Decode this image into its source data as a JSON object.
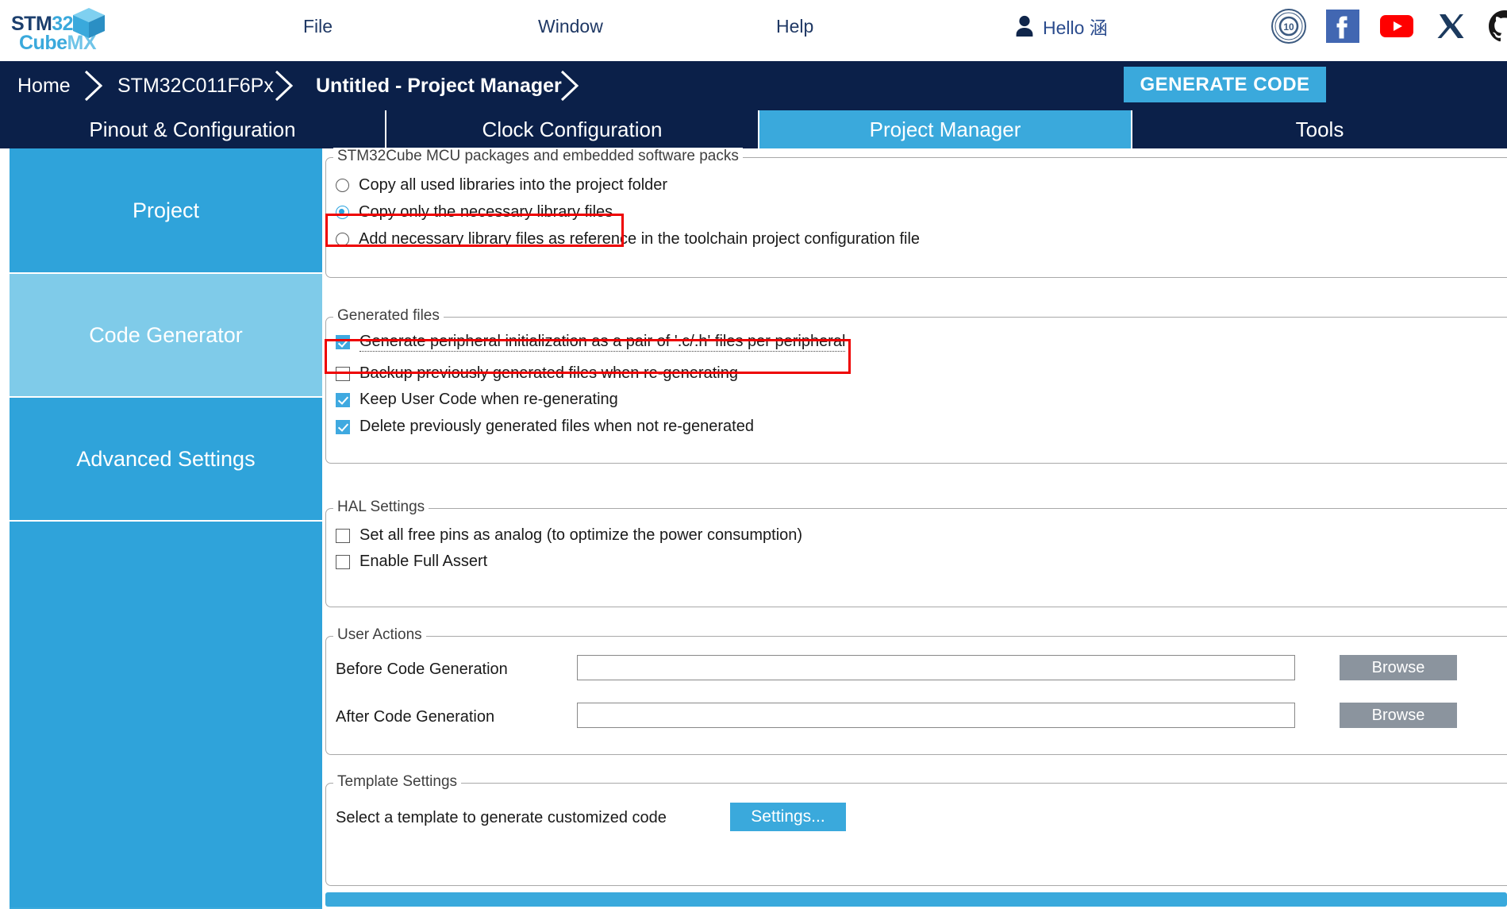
{
  "app": {
    "logo": {
      "line1_a": "STM",
      "line1_b": "32",
      "line2_a": "Cube",
      "line2_b": "MX"
    },
    "menu": [
      {
        "id": "file",
        "label": "File"
      },
      {
        "id": "window",
        "label": "Window"
      },
      {
        "id": "help",
        "label": "Help"
      }
    ],
    "user": {
      "greeting": "Hello 涵",
      "icon": "person-icon"
    },
    "social_icons": [
      {
        "name": "anniversary-10-badge-icon",
        "title": "10 Years"
      },
      {
        "name": "facebook-icon",
        "title": "Facebook"
      },
      {
        "name": "youtube-icon",
        "title": "YouTube"
      },
      {
        "name": "x-twitter-icon",
        "title": "X"
      },
      {
        "name": "github-icon",
        "title": "GitHub"
      }
    ]
  },
  "breadcrumb": {
    "items": [
      {
        "label": "Home"
      },
      {
        "label": "STM32C011F6Px"
      },
      {
        "label": "Untitled - Project Manager"
      }
    ],
    "generate_code_label": "GENERATE CODE"
  },
  "tabs": [
    {
      "label": "Pinout & Configuration",
      "active": false
    },
    {
      "label": "Clock Configuration",
      "active": false
    },
    {
      "label": "Project Manager",
      "active": true
    },
    {
      "label": "Tools",
      "active": false
    }
  ],
  "sidebar": {
    "items": [
      {
        "label": "Project",
        "selected": false
      },
      {
        "label": "Code Generator",
        "selected": true
      },
      {
        "label": "Advanced Settings",
        "selected": false
      }
    ]
  },
  "groups": {
    "packages": {
      "legend": "STM32Cube MCU packages and embedded software packs",
      "options": [
        {
          "label": "Copy all used libraries into the project folder",
          "checked": false
        },
        {
          "label": "Copy only the necessary library files",
          "checked": true,
          "highlighted": true
        },
        {
          "label": "Add necessary library files as reference in the toolchain project configuration file",
          "checked": false
        }
      ]
    },
    "generated_files": {
      "legend": "Generated files",
      "options": [
        {
          "label": "Generate peripheral initialization as a pair of '.c/.h' files per peripheral",
          "checked": true,
          "highlighted": true
        },
        {
          "label": "Backup previously generated files when re-generating",
          "checked": false
        },
        {
          "label": "Keep User Code when re-generating",
          "checked": true
        },
        {
          "label": "Delete previously generated files when not re-generated",
          "checked": true
        }
      ]
    },
    "hal_settings": {
      "legend": "HAL Settings",
      "options": [
        {
          "label": "Set all free pins as analog (to optimize the power consumption)",
          "checked": false
        },
        {
          "label": "Enable Full Assert",
          "checked": false
        }
      ]
    },
    "user_actions": {
      "legend": "User Actions",
      "rows": [
        {
          "label": "Before Code Generation",
          "value": "",
          "placeholder": "",
          "button": "Browse"
        },
        {
          "label": "After Code Generation",
          "value": "",
          "placeholder": "",
          "button": "Browse"
        }
      ]
    },
    "template_settings": {
      "legend": "Template Settings",
      "description": "Select a template to generate customized code",
      "button": "Settings..."
    }
  },
  "colors": {
    "brand_blue": "#3aa9dc",
    "navy": "#0b2049",
    "highlight_red": "#ee0000",
    "sidebar_selected": "#7fcbe9",
    "browse_gray": "#8b949e"
  }
}
